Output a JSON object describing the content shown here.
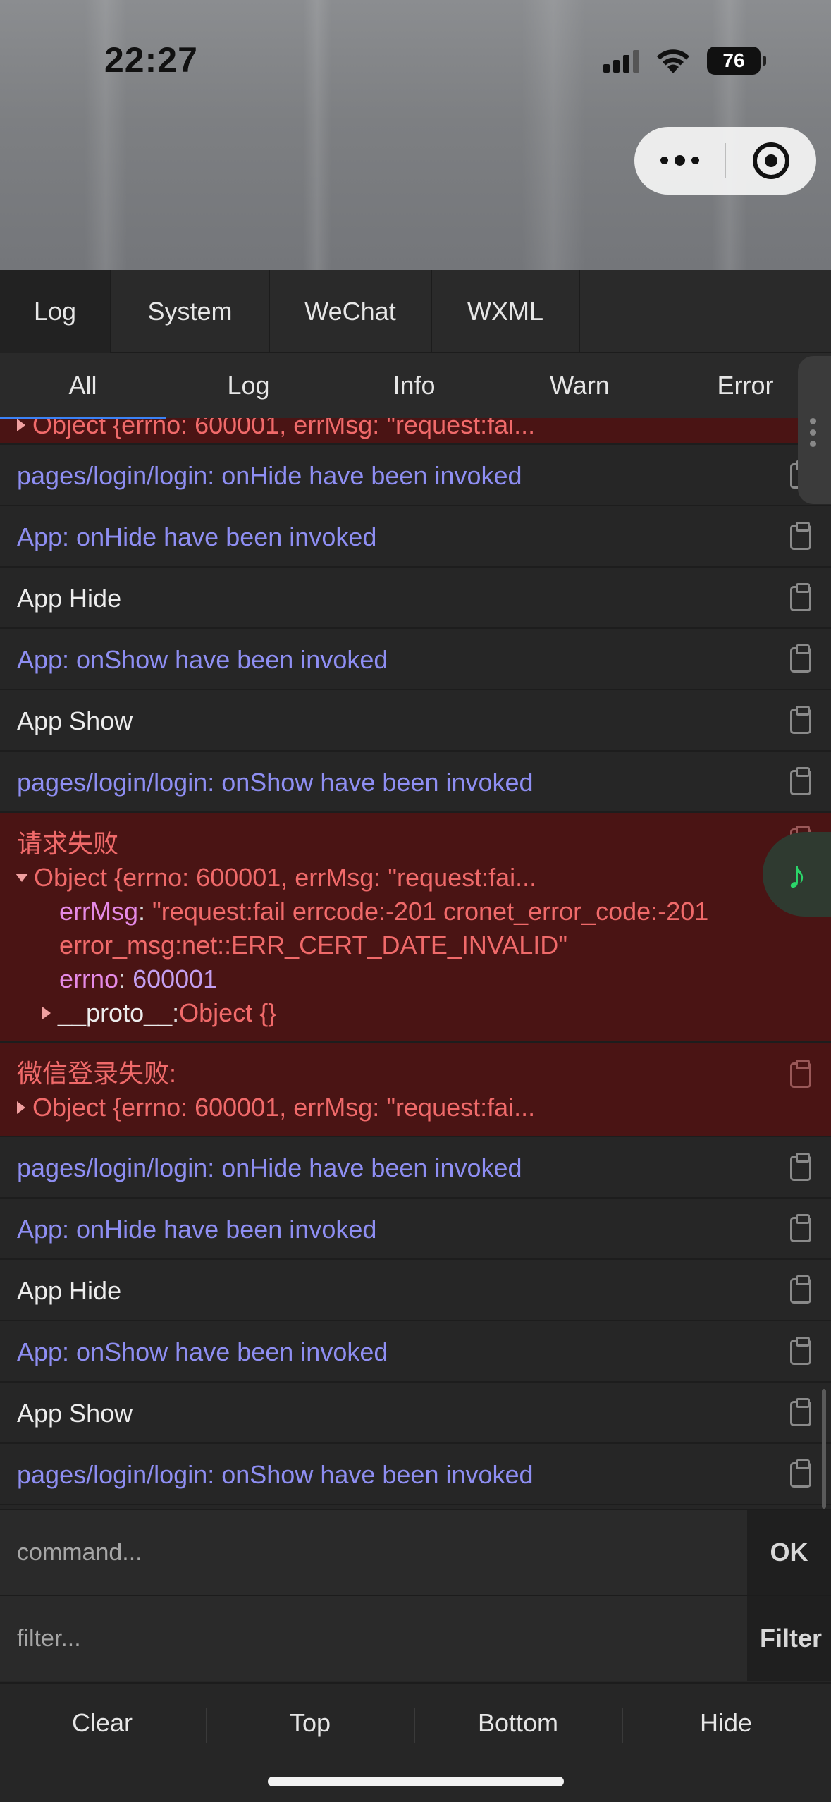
{
  "status_bar": {
    "time": "22:27",
    "battery": "76"
  },
  "main_tabs": [
    {
      "label": "Log",
      "active": true
    },
    {
      "label": "System",
      "active": false
    },
    {
      "label": "WeChat",
      "active": false
    },
    {
      "label": "WXML",
      "active": false
    }
  ],
  "sub_tabs": [
    {
      "label": "All",
      "active": true
    },
    {
      "label": "Log",
      "active": false
    },
    {
      "label": "Info",
      "active": false
    },
    {
      "label": "Warn",
      "active": false
    },
    {
      "label": "Error",
      "active": false
    }
  ],
  "logs": {
    "partial_top": "Object {errno: 600001, errMsg: \"request:fai...",
    "rows_a": [
      {
        "text": "pages/login/login: onHide have been invoked",
        "color": "#8e8ef2"
      },
      {
        "text": "App: onHide have been invoked",
        "color": "#8e8ef2"
      },
      {
        "text": "App Hide",
        "color": "#ececec"
      },
      {
        "text": "App: onShow have been invoked",
        "color": "#8e8ef2"
      },
      {
        "text": "App Show",
        "color": "#ececec"
      },
      {
        "text": "pages/login/login: onShow have been invoked",
        "color": "#8e8ef2"
      }
    ],
    "error_1": {
      "title": "请求失败",
      "object": "Object {errno: 600001, errMsg: \"request:fai...",
      "errMsg_key": "errMsg",
      "errMsg_value_1": "\"request:fail errcode:-201 cronet_error_code:-201",
      "errMsg_value_2": "error_msg:net::ERR_CERT_DATE_INVALID\"",
      "errno_key": "errno",
      "errno_value": "600001",
      "proto_key": "__proto__",
      "proto_value": "Object {}"
    },
    "error_2": {
      "title": "微信登录失败:",
      "object": "Object {errno: 600001, errMsg: \"request:fai..."
    },
    "rows_b": [
      {
        "text": "pages/login/login: onHide have been invoked",
        "color": "#8e8ef2"
      },
      {
        "text": "App: onHide have been invoked",
        "color": "#8e8ef2"
      },
      {
        "text": "App Hide",
        "color": "#ececec"
      },
      {
        "text": "App: onShow have been invoked",
        "color": "#8e8ef2"
      },
      {
        "text": "App Show",
        "color": "#ececec"
      },
      {
        "text": "pages/login/login: onShow have been invoked",
        "color": "#8e8ef2"
      }
    ]
  },
  "command": {
    "placeholder": "command...",
    "button": "OK"
  },
  "filter": {
    "placeholder": "filter...",
    "button": "Filter"
  },
  "actions": {
    "clear": "Clear",
    "top": "Top",
    "bottom": "Bottom",
    "hide": "Hide"
  },
  "colors": {
    "accent": "#3b82f6",
    "error_bg": "#4a1414",
    "error_text": "#f06a6a",
    "info_text": "#8e8ef2"
  }
}
